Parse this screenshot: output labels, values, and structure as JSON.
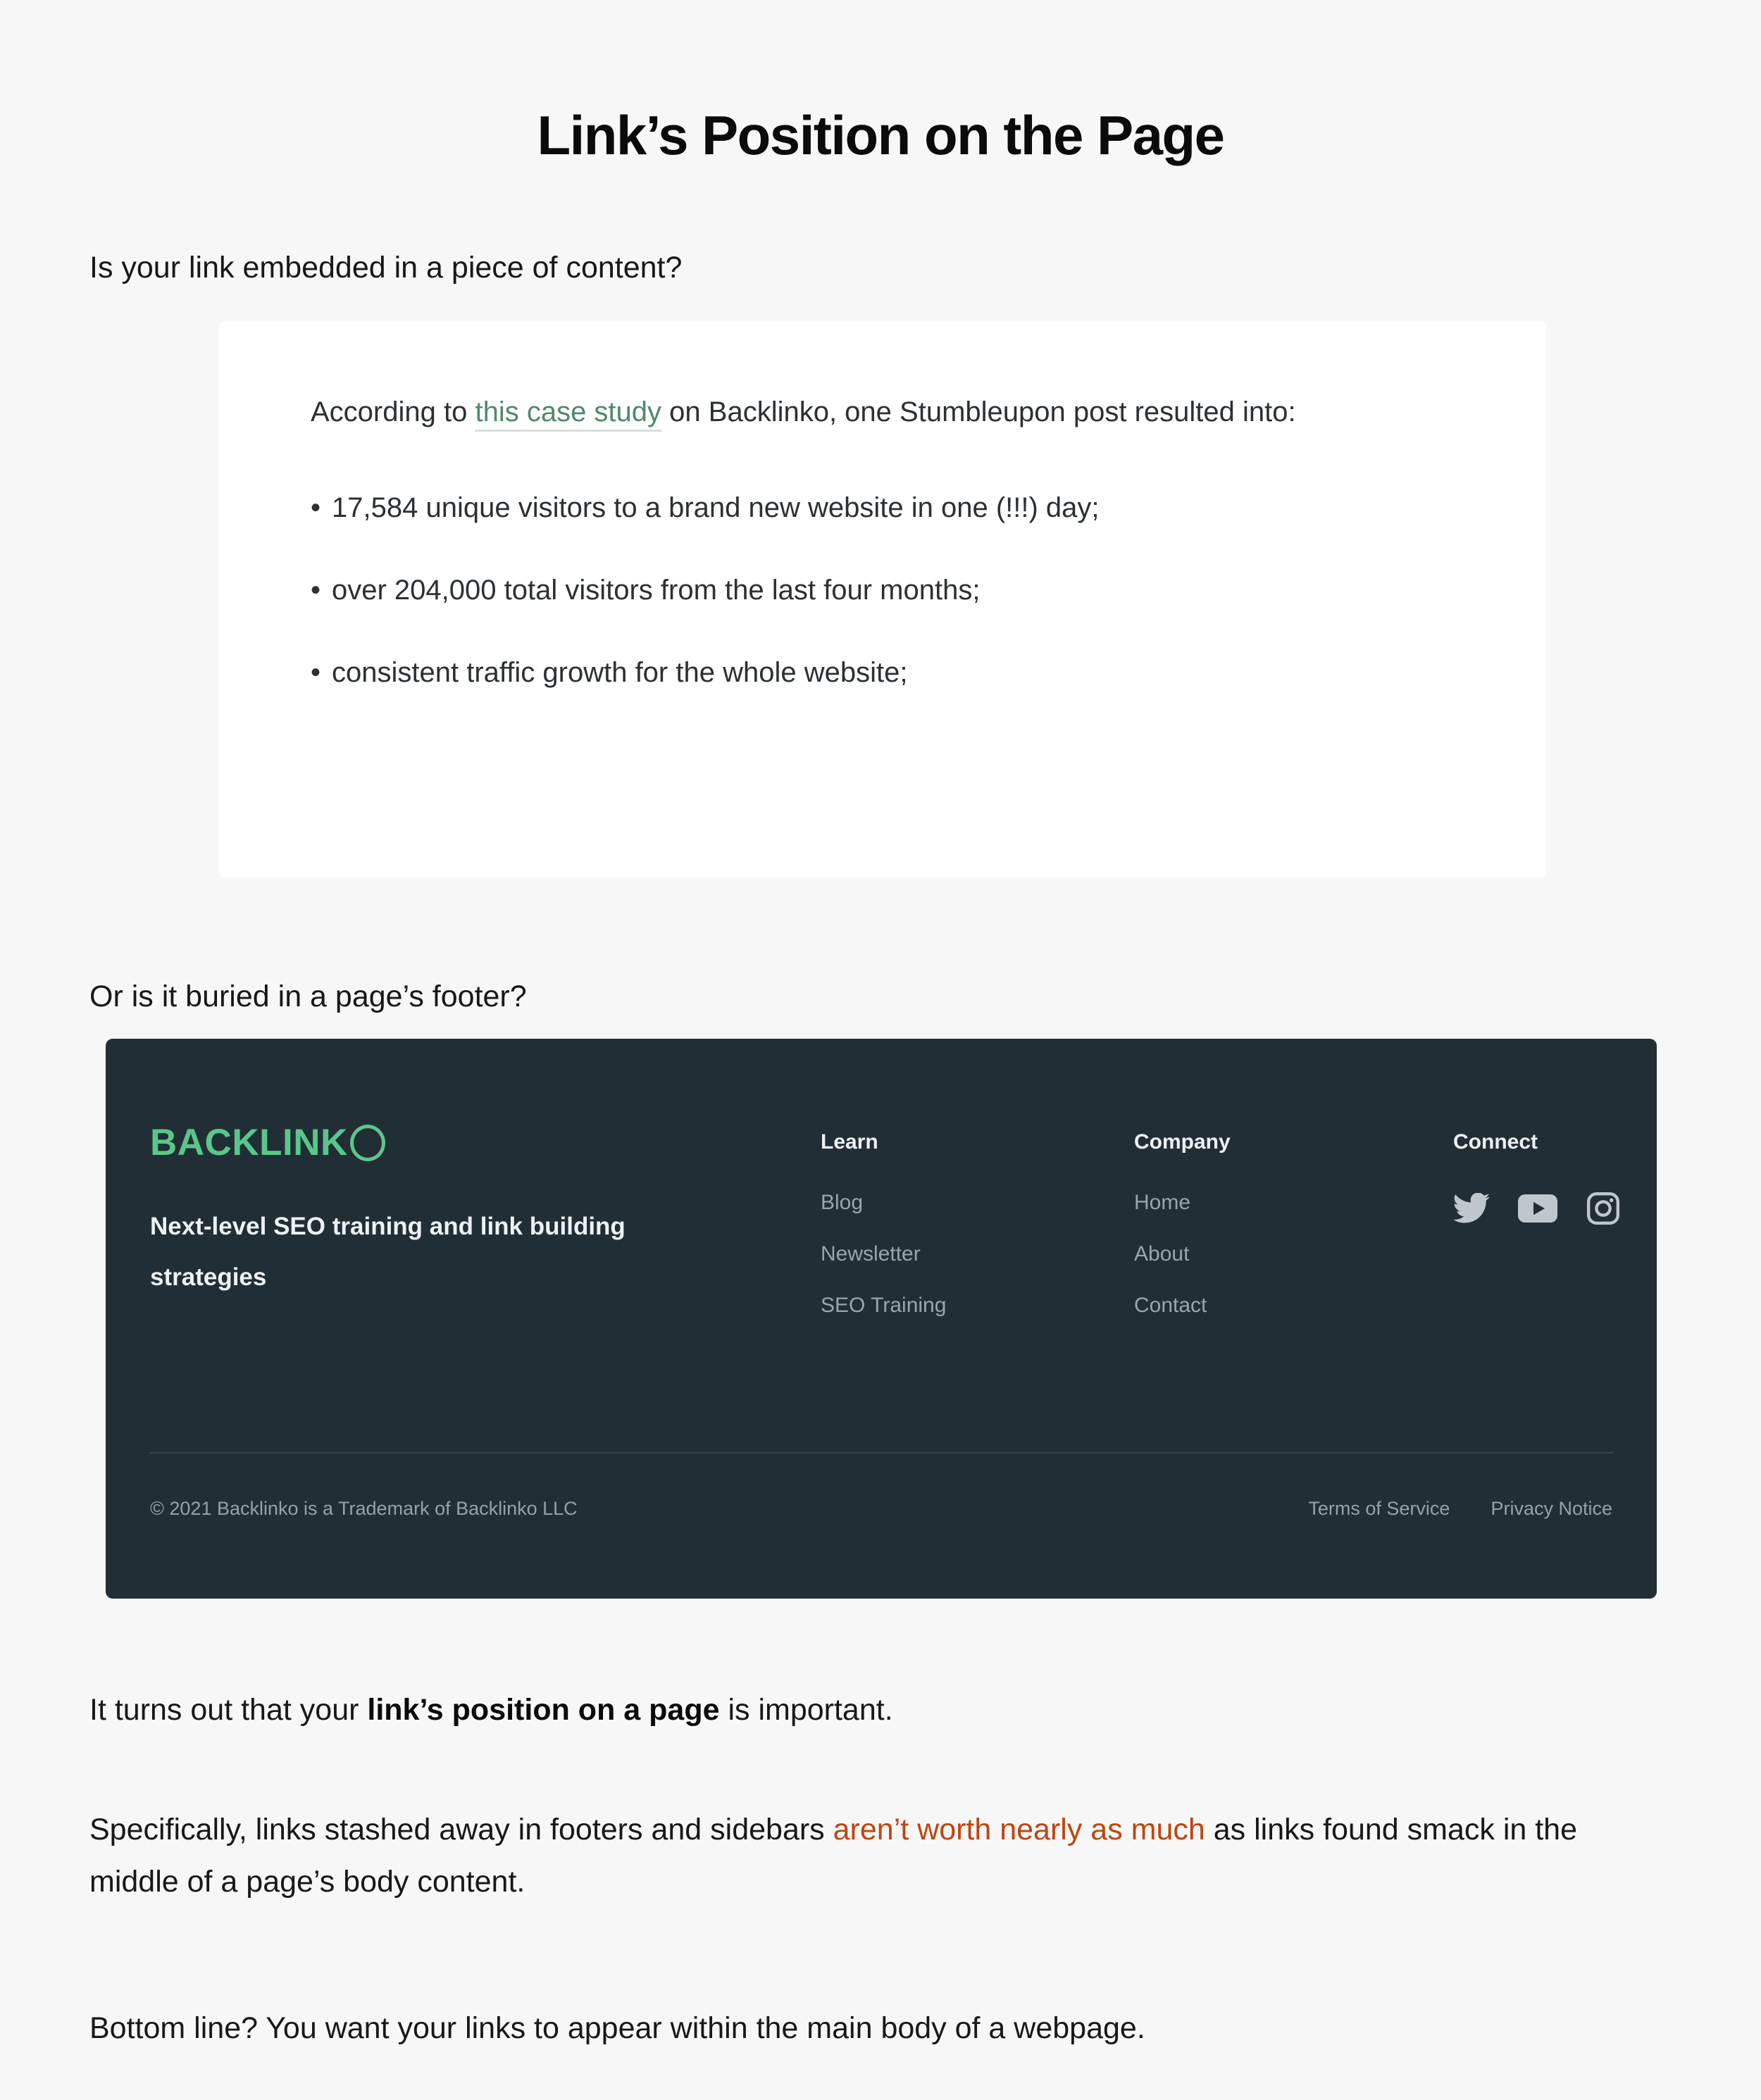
{
  "heading": "Link’s Position on the Page",
  "intro_question": "Is your link embedded in a piece of content?",
  "second_question": "Or is it buried in a page’s footer?",
  "screenshot_card": {
    "lead_before_link": "According to ",
    "lead_link": "this case study",
    "lead_after_link": " on Backlinko, one Stumbleupon post resulted into:",
    "bullets": [
      "17,584 unique visitors to a brand new website in one (!!!) day;",
      "over 204,000 total visitors from the last four months;",
      "consistent traffic growth for the whole website;"
    ],
    "bullet_marker": "•",
    "link_color": "#4e8a6b",
    "background": "#ffffff"
  },
  "footer_screenshot": {
    "background": "#222e36",
    "logo_text": "BACKLINK",
    "logo_ring_letter": "O",
    "logo_color": "#5ac68b",
    "tagline": "Next-level SEO training and link building strategies",
    "columns": [
      {
        "heading": "Learn",
        "links": [
          "Blog",
          "Newsletter",
          "SEO Training"
        ]
      },
      {
        "heading": "Company",
        "links": [
          "Home",
          "About",
          "Contact"
        ]
      }
    ],
    "connect": {
      "heading": "Connect",
      "icons": [
        "twitter-icon",
        "youtube-icon",
        "instagram-icon"
      ]
    },
    "copyright": "© 2021 Backlinko is a Trademark of Backlinko LLC",
    "legal_links": [
      "Terms of Service",
      "Privacy Notice"
    ]
  },
  "paragraphs": {
    "p1_before": "It turns out that your ",
    "p1_bold": "link’s position on a page",
    "p1_after": " is important.",
    "p2_before": "Specifically, links stashed away in footers and sidebars ",
    "p2_link": "aren’t worth nearly as much",
    "p2_after": " as links found smack in the middle of a page’s body content.",
    "p2_link_color": "#c1440e",
    "p3": "Bottom line? You want your links to appear within the main body of a webpage."
  }
}
